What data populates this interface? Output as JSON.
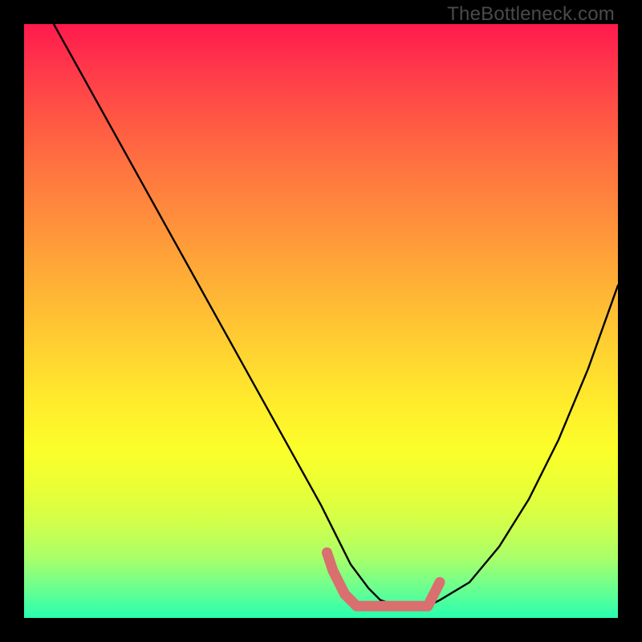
{
  "watermark": "TheBottleneck.com",
  "chart_data": {
    "type": "line",
    "title": "",
    "subtitle": "",
    "xlabel": "",
    "ylabel": "",
    "xlim": [
      0,
      100
    ],
    "ylim": [
      0,
      100
    ],
    "grid": false,
    "legend": null,
    "annotations": [],
    "series": [
      {
        "name": "main-curve",
        "color": "#000000",
        "x": [
          5,
          10,
          15,
          20,
          25,
          30,
          35,
          40,
          45,
          50,
          53,
          55,
          58,
          60,
          63,
          65,
          68,
          70,
          75,
          80,
          85,
          90,
          95,
          100
        ],
        "y": [
          100,
          91,
          82,
          73,
          64,
          55,
          46,
          37,
          28,
          19,
          13,
          9,
          5,
          3,
          2,
          2,
          2,
          3,
          6,
          12,
          20,
          30,
          42,
          56
        ]
      },
      {
        "name": "floor-marker-left",
        "color": "#d96f6f",
        "x": [
          51,
          52,
          53,
          54,
          55,
          56
        ],
        "y": [
          11,
          8,
          6,
          4,
          3,
          2
        ]
      },
      {
        "name": "floor-marker-mid",
        "color": "#d96f6f",
        "x": [
          56,
          58,
          60,
          62,
          64,
          66,
          68
        ],
        "y": [
          2,
          2,
          2,
          2,
          2,
          2,
          2
        ]
      },
      {
        "name": "floor-marker-right",
        "color": "#d96f6f",
        "x": [
          68,
          69,
          70
        ],
        "y": [
          2,
          4,
          6
        ]
      }
    ]
  }
}
